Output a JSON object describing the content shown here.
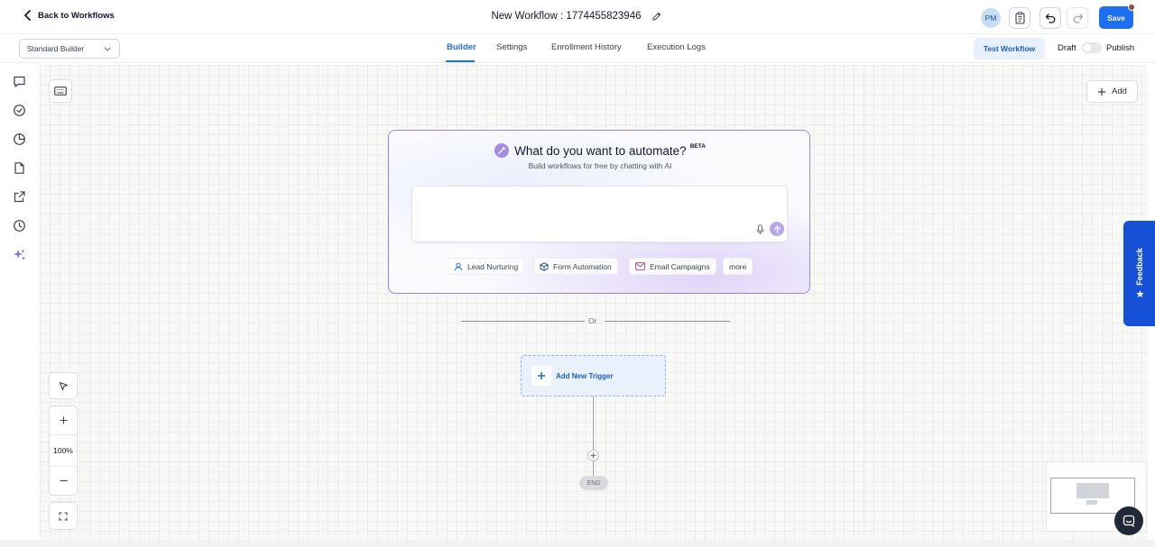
{
  "header": {
    "back_label": "Back to Workflows",
    "workflow_title": "New Workflow : 1774455823946",
    "avatar_initials": "PM",
    "save_label": "Save"
  },
  "subbar": {
    "builder_mode": "Standard Builder",
    "tabs": [
      {
        "label": "Builder",
        "active": true
      },
      {
        "label": "Settings",
        "active": false
      },
      {
        "label": "Enrollment History",
        "active": false
      },
      {
        "label": "Execution Logs",
        "active": false
      }
    ],
    "test_workflow_label": "Test Workflow",
    "draft_label": "Draft",
    "publish_label": "Publish",
    "publish_enabled": false
  },
  "left_rail": {
    "icons": [
      "chat-icon",
      "check-circle-icon",
      "pie-chart-icon",
      "document-icon",
      "external-link-icon",
      "clock-history-icon",
      "ai-sparkle-icon"
    ]
  },
  "canvas": {
    "add_label": "Add",
    "ai_card": {
      "title": "What do you want to automate?",
      "badge": "BETA",
      "subtitle": "Build workflows for free by chatting with AI",
      "input_value": "",
      "suggestions": [
        {
          "label": "Lead Nurturing",
          "icon": "user-icon"
        },
        {
          "label": "Form Automation",
          "icon": "cube-icon"
        },
        {
          "label": "Email Campaigns",
          "icon": "mail-icon"
        },
        {
          "label": "more",
          "icon": ""
        }
      ]
    },
    "or_label": "Or",
    "trigger_label": "Add New Trigger",
    "end_label": "END",
    "zoom_level": "100%"
  },
  "feedback_label": "Feedback",
  "colors": {
    "primary": "#1d6ff2",
    "ai_accent": "#9b87e0",
    "feedback": "#1650d6"
  }
}
